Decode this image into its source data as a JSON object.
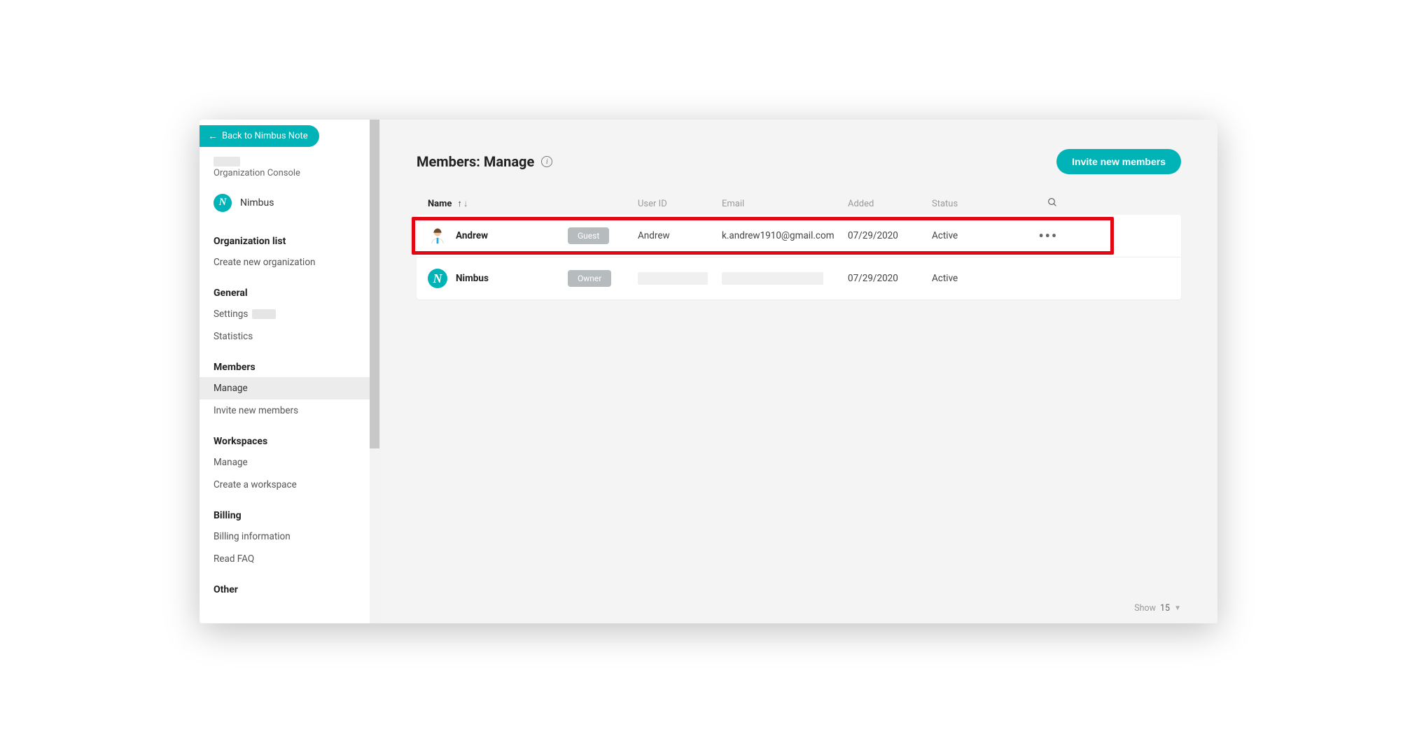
{
  "back_button": "Back to Nimbus Note",
  "org_console_label": "Organization Console",
  "selected_org": "Nimbus",
  "nav": {
    "org_list_heading": "Organization list",
    "create_org": "Create new organization",
    "general_heading": "General",
    "settings": "Settings",
    "statistics": "Statistics",
    "members_heading": "Members",
    "manage": "Manage",
    "invite": "Invite new members",
    "workspaces_heading": "Workspaces",
    "ws_manage": "Manage",
    "ws_create": "Create a workspace",
    "billing_heading": "Billing",
    "billing_info": "Billing information",
    "faq": "Read FAQ",
    "other_heading": "Other"
  },
  "page_title": "Members: Manage",
  "invite_button": "Invite new members",
  "columns": {
    "name": "Name",
    "user_id": "User ID",
    "email": "Email",
    "added": "Added",
    "status": "Status"
  },
  "rows": [
    {
      "name": "Andrew",
      "role": "Guest",
      "user_id": "Andrew",
      "email": "k.andrew1910@gmail.com",
      "added": "07/29/2020",
      "status": "Active",
      "avatar": "person",
      "highlighted": true,
      "has_actions": true,
      "redacted": false
    },
    {
      "name": "Nimbus",
      "role": "Owner",
      "user_id": "",
      "email": "",
      "added": "07/29/2020",
      "status": "Active",
      "avatar": "nimbus",
      "highlighted": false,
      "has_actions": false,
      "redacted": true
    }
  ],
  "footer": {
    "label": "Show",
    "value": "15"
  }
}
